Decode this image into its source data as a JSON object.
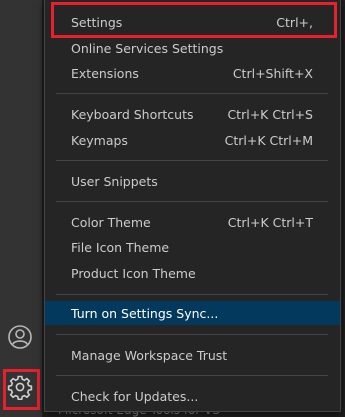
{
  "menu": {
    "items": [
      {
        "label": "Settings",
        "shortcut": "Ctrl+,"
      },
      {
        "label": "Online Services Settings",
        "shortcut": ""
      },
      {
        "label": "Extensions",
        "shortcut": "Ctrl+Shift+X"
      },
      {
        "label": "Keyboard Shortcuts",
        "shortcut": "Ctrl+K Ctrl+S"
      },
      {
        "label": "Keymaps",
        "shortcut": "Ctrl+K Ctrl+M"
      },
      {
        "label": "User Snippets",
        "shortcut": ""
      },
      {
        "label": "Color Theme",
        "shortcut": "Ctrl+K Ctrl+T"
      },
      {
        "label": "File Icon Theme",
        "shortcut": ""
      },
      {
        "label": "Product Icon Theme",
        "shortcut": ""
      },
      {
        "label": "Turn on Settings Sync...",
        "shortcut": ""
      },
      {
        "label": "Manage Workspace Trust",
        "shortcut": ""
      },
      {
        "label": "Check for Updates...",
        "shortcut": ""
      }
    ],
    "active_item": "Turn on Settings Sync..."
  },
  "activity_bar": {
    "account_icon": "account-icon",
    "manage_icon": "gear-icon"
  },
  "editor": {
    "peek_text": "Microsoft Edge Tools for VS"
  },
  "colors": {
    "highlight": "#e8202d",
    "active_item_bg": "#04395e",
    "menu_bg": "#252526"
  }
}
